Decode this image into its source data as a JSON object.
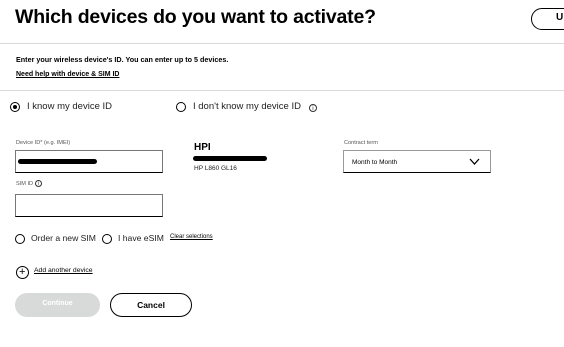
{
  "header": {
    "title": "Which devices do you want to activate?",
    "top_button_label": "U"
  },
  "intro": {
    "text": "Enter your wireless device's ID. You can enter up to 5 devices.",
    "help_link": "Need help with device & SIM ID"
  },
  "id_options": {
    "know": {
      "label": "I know my device ID",
      "selected": true
    },
    "dont_know": {
      "label": "I don't know my device ID",
      "selected": false
    }
  },
  "device_id_field": {
    "label": "Device ID* (e.g. IMEI)",
    "value_redacted": true
  },
  "sim_id_field": {
    "label": "SIM ID",
    "value": ""
  },
  "device": {
    "name": "HPI",
    "model": "HP L860 GL16",
    "serial_redacted": true
  },
  "contract": {
    "label": "Contract term",
    "selected": "Month to Month"
  },
  "sim_options": {
    "new_sim": "Order a new SIM",
    "esim": "I have eSIM",
    "clear": "Clear selections"
  },
  "add_device": {
    "label": "Add another device"
  },
  "actions": {
    "continue": "Continue",
    "cancel": "Cancel"
  },
  "colors": {
    "disabled_button": "#d8dada",
    "divider": "#d8dada",
    "text": "#000000"
  }
}
